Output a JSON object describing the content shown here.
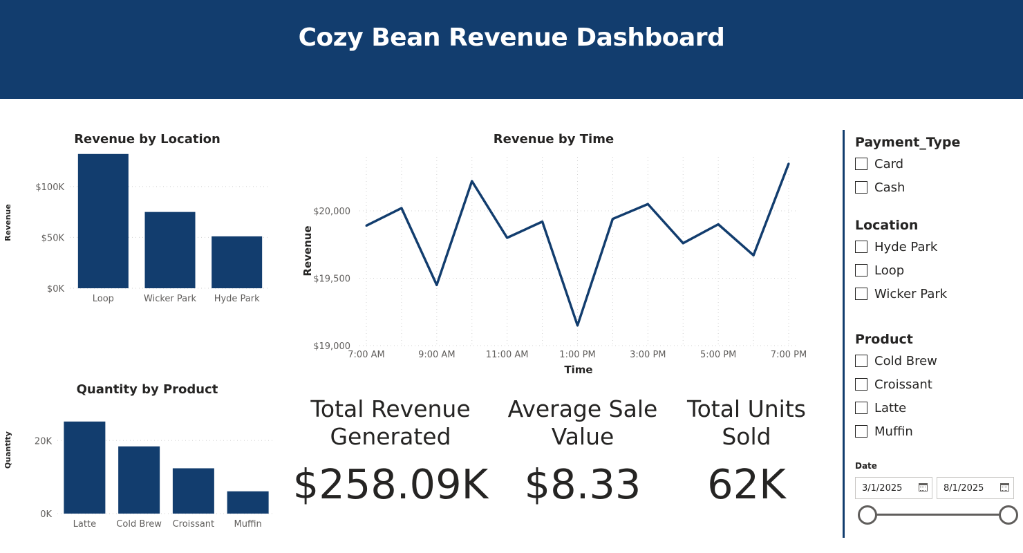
{
  "header": {
    "title": "Cozy Bean Revenue Dashboard",
    "bg_color": "#123d6e"
  },
  "colors": {
    "accent": "#123d6e"
  },
  "chart_data": [
    {
      "id": "location",
      "type": "bar",
      "title": "Revenue by Location",
      "ylabel": "Revenue",
      "xlabel": "",
      "categories": [
        "Loop",
        "Wicker Park",
        "Hyde Park"
      ],
      "values": [
        132000,
        75000,
        51000
      ],
      "ylim": [
        0,
        140000
      ],
      "yticks": [
        0,
        50000,
        100000
      ],
      "ytick_labels": [
        "$0K",
        "$50K",
        "$100K"
      ],
      "grid": true
    },
    {
      "id": "product",
      "type": "bar",
      "title": "Quantity by Product",
      "ylabel": "Quantity",
      "xlabel": "",
      "categories": [
        "Latte",
        "Cold Brew",
        "Croissant",
        "Muffin"
      ],
      "values": [
        25200,
        18400,
        12400,
        6100
      ],
      "ylim": [
        0,
        28000
      ],
      "yticks": [
        0,
        20000
      ],
      "ytick_labels": [
        "0K",
        "20K"
      ],
      "grid": true
    },
    {
      "id": "time",
      "type": "line",
      "title": "Revenue by Time",
      "ylabel": "Revenue",
      "xlabel": "Time",
      "x": [
        7,
        8,
        9,
        10,
        11,
        12,
        13,
        14,
        15,
        16,
        17,
        18,
        19
      ],
      "values": [
        19890,
        20020,
        19450,
        20220,
        19800,
        19920,
        19150,
        19940,
        20050,
        19760,
        19900,
        19670,
        20350
      ],
      "xticks": [
        7,
        9,
        11,
        13,
        15,
        17,
        19
      ],
      "xtick_labels": [
        "7:00 AM",
        "9:00 AM",
        "11:00 AM",
        "1:00 PM",
        "3:00 PM",
        "5:00 PM",
        "7:00 PM"
      ],
      "ylim": [
        19000,
        20400
      ],
      "yticks": [
        19000,
        19500,
        20000
      ],
      "ytick_labels": [
        "$19,000",
        "$19,500",
        "$20,000"
      ],
      "grid": true
    }
  ],
  "kpis": [
    {
      "title": "Total Revenue Generated",
      "value": "$258.09K"
    },
    {
      "title": "Average Sale Value",
      "value": "$8.33"
    },
    {
      "title": "Total Units Sold",
      "value": "62K"
    }
  ],
  "slicers": {
    "payment": {
      "title": "Payment_Type",
      "items": [
        "Card",
        "Cash"
      ]
    },
    "location": {
      "title": "Location",
      "items": [
        "Hyde Park",
        "Loop",
        "Wicker Park"
      ]
    },
    "product": {
      "title": "Product",
      "items": [
        "Cold Brew",
        "Croissant",
        "Latte",
        "Muffin"
      ]
    },
    "date": {
      "title": "Date",
      "start": "3/1/2025",
      "end": "8/1/2025"
    }
  }
}
